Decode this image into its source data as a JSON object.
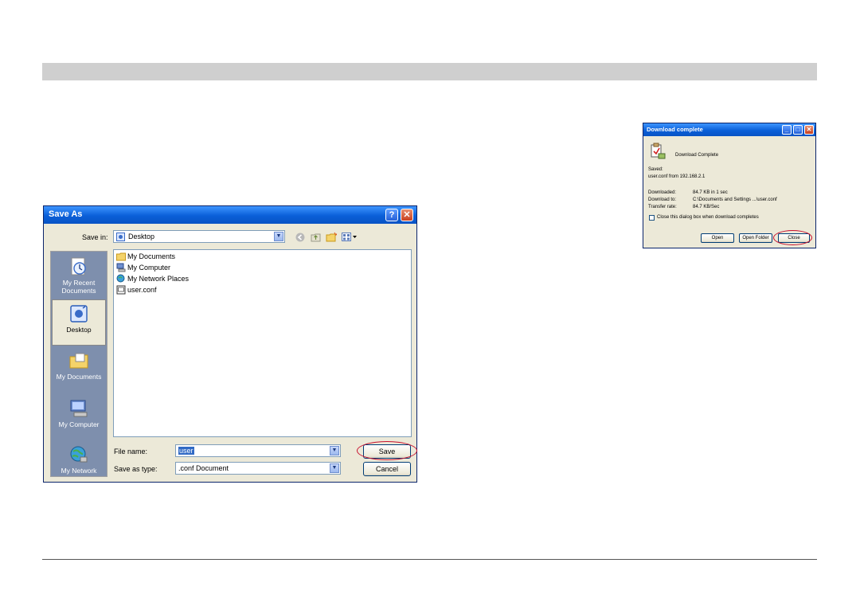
{
  "saveas": {
    "title": "Save As",
    "help_glyph": "?",
    "close_glyph": "✕",
    "save_in_label": "Save in:",
    "save_in_value": "Desktop",
    "places": [
      {
        "label": "My Recent Documents",
        "icon": "recent-documents-icon"
      },
      {
        "label": "Desktop",
        "icon": "desktop-icon"
      },
      {
        "label": "My Documents",
        "icon": "my-documents-folder-icon"
      },
      {
        "label": "My Computer",
        "icon": "my-computer-icon"
      },
      {
        "label": "My Network",
        "icon": "network-icon"
      }
    ],
    "files": [
      {
        "name": "My Documents",
        "icon": "folder-icon"
      },
      {
        "name": "My Computer",
        "icon": "computer-icon"
      },
      {
        "name": "My Network Places",
        "icon": "network-icon"
      },
      {
        "name": "user.conf",
        "icon": "file-icon"
      }
    ],
    "file_name_label": "File name:",
    "file_name_value": "user",
    "save_as_type_label": "Save as type:",
    "save_as_type_value": ".conf Document",
    "save_button": "Save",
    "cancel_button": "Cancel",
    "accent_color": "#0a5fd8",
    "highlight_color": "#c8102e"
  },
  "download": {
    "title": "Download complete",
    "heading": "Download Complete",
    "saved_label": "Saved:",
    "saved_value": "user.conf from 192.168.2.1",
    "downloaded_label": "Downloaded:",
    "downloaded_value": "84.7 KB in 1 sec",
    "download_to_label": "Download to:",
    "download_to_value": "C:\\Documents and Settings ...\\user.conf",
    "transfer_rate_label": "Transfer rate:",
    "transfer_rate_value": "84.7 KB/Sec",
    "checkbox_label": "Close this dialog box when download completes",
    "open_button": "Open",
    "open_folder_button": "Open Folder",
    "close_button": "Close",
    "min_glyph": "_",
    "max_glyph": "□",
    "close_glyph": "✕"
  }
}
